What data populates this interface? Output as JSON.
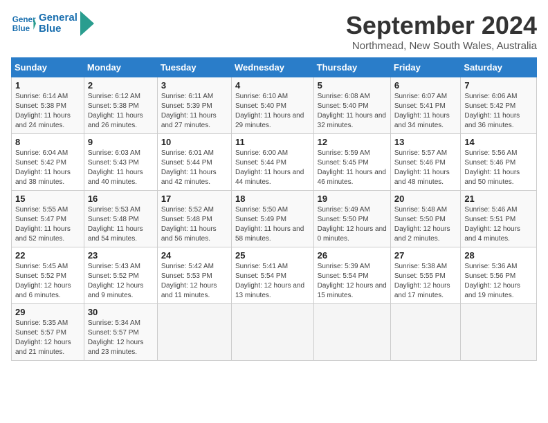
{
  "header": {
    "logo_line1": "General",
    "logo_line2": "Blue",
    "month": "September 2024",
    "location": "Northmead, New South Wales, Australia"
  },
  "weekdays": [
    "Sunday",
    "Monday",
    "Tuesday",
    "Wednesday",
    "Thursday",
    "Friday",
    "Saturday"
  ],
  "weeks": [
    [
      {
        "day": "1",
        "sunrise": "6:14 AM",
        "sunset": "5:38 PM",
        "daylight": "11 hours and 24 minutes."
      },
      {
        "day": "2",
        "sunrise": "6:12 AM",
        "sunset": "5:38 PM",
        "daylight": "11 hours and 26 minutes."
      },
      {
        "day": "3",
        "sunrise": "6:11 AM",
        "sunset": "5:39 PM",
        "daylight": "11 hours and 27 minutes."
      },
      {
        "day": "4",
        "sunrise": "6:10 AM",
        "sunset": "5:40 PM",
        "daylight": "11 hours and 29 minutes."
      },
      {
        "day": "5",
        "sunrise": "6:08 AM",
        "sunset": "5:40 PM",
        "daylight": "11 hours and 32 minutes."
      },
      {
        "day": "6",
        "sunrise": "6:07 AM",
        "sunset": "5:41 PM",
        "daylight": "11 hours and 34 minutes."
      },
      {
        "day": "7",
        "sunrise": "6:06 AM",
        "sunset": "5:42 PM",
        "daylight": "11 hours and 36 minutes."
      }
    ],
    [
      {
        "day": "8",
        "sunrise": "6:04 AM",
        "sunset": "5:42 PM",
        "daylight": "11 hours and 38 minutes."
      },
      {
        "day": "9",
        "sunrise": "6:03 AM",
        "sunset": "5:43 PM",
        "daylight": "11 hours and 40 minutes."
      },
      {
        "day": "10",
        "sunrise": "6:01 AM",
        "sunset": "5:44 PM",
        "daylight": "11 hours and 42 minutes."
      },
      {
        "day": "11",
        "sunrise": "6:00 AM",
        "sunset": "5:44 PM",
        "daylight": "11 hours and 44 minutes."
      },
      {
        "day": "12",
        "sunrise": "5:59 AM",
        "sunset": "5:45 PM",
        "daylight": "11 hours and 46 minutes."
      },
      {
        "day": "13",
        "sunrise": "5:57 AM",
        "sunset": "5:46 PM",
        "daylight": "11 hours and 48 minutes."
      },
      {
        "day": "14",
        "sunrise": "5:56 AM",
        "sunset": "5:46 PM",
        "daylight": "11 hours and 50 minutes."
      }
    ],
    [
      {
        "day": "15",
        "sunrise": "5:55 AM",
        "sunset": "5:47 PM",
        "daylight": "11 hours and 52 minutes."
      },
      {
        "day": "16",
        "sunrise": "5:53 AM",
        "sunset": "5:48 PM",
        "daylight": "11 hours and 54 minutes."
      },
      {
        "day": "17",
        "sunrise": "5:52 AM",
        "sunset": "5:48 PM",
        "daylight": "11 hours and 56 minutes."
      },
      {
        "day": "18",
        "sunrise": "5:50 AM",
        "sunset": "5:49 PM",
        "daylight": "11 hours and 58 minutes."
      },
      {
        "day": "19",
        "sunrise": "5:49 AM",
        "sunset": "5:50 PM",
        "daylight": "12 hours and 0 minutes."
      },
      {
        "day": "20",
        "sunrise": "5:48 AM",
        "sunset": "5:50 PM",
        "daylight": "12 hours and 2 minutes."
      },
      {
        "day": "21",
        "sunrise": "5:46 AM",
        "sunset": "5:51 PM",
        "daylight": "12 hours and 4 minutes."
      }
    ],
    [
      {
        "day": "22",
        "sunrise": "5:45 AM",
        "sunset": "5:52 PM",
        "daylight": "12 hours and 6 minutes."
      },
      {
        "day": "23",
        "sunrise": "5:43 AM",
        "sunset": "5:52 PM",
        "daylight": "12 hours and 9 minutes."
      },
      {
        "day": "24",
        "sunrise": "5:42 AM",
        "sunset": "5:53 PM",
        "daylight": "12 hours and 11 minutes."
      },
      {
        "day": "25",
        "sunrise": "5:41 AM",
        "sunset": "5:54 PM",
        "daylight": "12 hours and 13 minutes."
      },
      {
        "day": "26",
        "sunrise": "5:39 AM",
        "sunset": "5:54 PM",
        "daylight": "12 hours and 15 minutes."
      },
      {
        "day": "27",
        "sunrise": "5:38 AM",
        "sunset": "5:55 PM",
        "daylight": "12 hours and 17 minutes."
      },
      {
        "day": "28",
        "sunrise": "5:36 AM",
        "sunset": "5:56 PM",
        "daylight": "12 hours and 19 minutes."
      }
    ],
    [
      {
        "day": "29",
        "sunrise": "5:35 AM",
        "sunset": "5:57 PM",
        "daylight": "12 hours and 21 minutes."
      },
      {
        "day": "30",
        "sunrise": "5:34 AM",
        "sunset": "5:57 PM",
        "daylight": "12 hours and 23 minutes."
      },
      null,
      null,
      null,
      null,
      null
    ]
  ]
}
